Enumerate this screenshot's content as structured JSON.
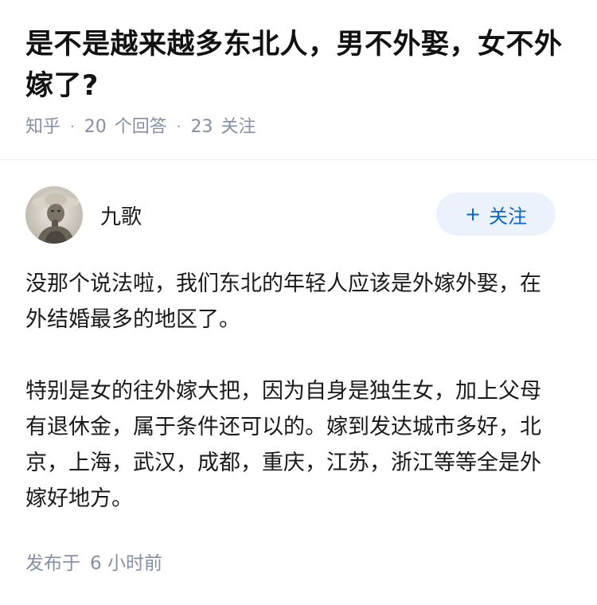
{
  "question": {
    "title": "是不是越来越多东北人，男不外娶，女不外嫁了?",
    "source": "知乎",
    "separator": "·",
    "answers_count": "20",
    "answers_label": "个回答",
    "followers_count": "23",
    "followers_label": "关注"
  },
  "author": {
    "name": "九歌",
    "avatar_icon": "avatar-photo"
  },
  "follow_button": {
    "icon": "+",
    "label": "关注"
  },
  "answer": {
    "paragraphs": [
      "没那个说法啦，我们东北的年轻人应该是外嫁外娶，在外结婚最多的地区了。",
      "特别是女的往外嫁大把，因为自身是独生女，加上父母有退休金，属于条件还可以的。嫁到发达城市多好，北京，上海，武汉，成都，重庆，江苏，浙江等等全是外嫁好地方。"
    ],
    "published_label": "发布于",
    "published_time": "6 小时前"
  },
  "colors": {
    "meta_gray": "#8590a6",
    "accent_blue": "#0a66c2",
    "follow_bg": "#ebf2fb"
  }
}
